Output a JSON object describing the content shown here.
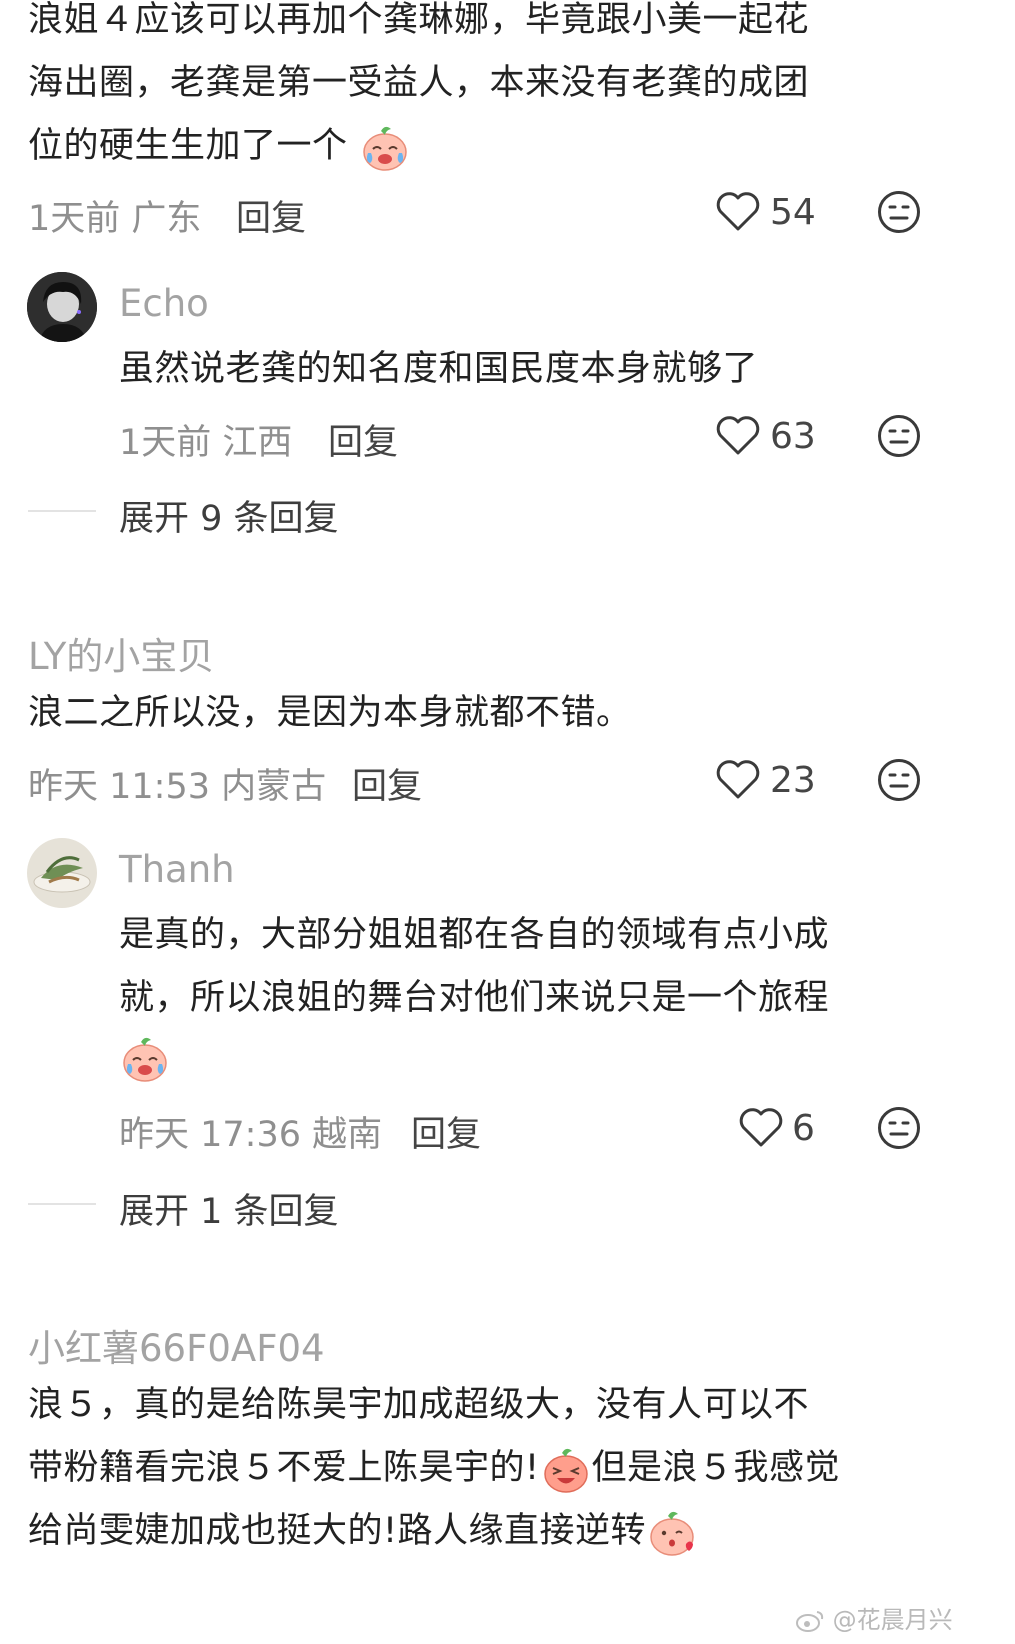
{
  "comments": [
    {
      "lines": [
        "浪姐４应该可以再加个龚琳娜，毕竟跟小美一起花",
        "海出圈，老龚是第一受益人，本来没有老龚的成团",
        "位的硬生生加了一个"
      ],
      "emoji": "crying-laughing-peach-emoji",
      "time_location": "1天前 广东",
      "reply": "回复",
      "likes": "54"
    },
    {
      "user": "Echo",
      "text": "虽然说老龚的知名度和国民度本身就够了",
      "time_location": "1天前 江西",
      "reply": "回复",
      "likes": "63"
    },
    {
      "expand": "展开 9 条回复"
    },
    {
      "user": "LY的小宝贝",
      "text": "浪二之所以没，是因为本身就都不错。",
      "time_location": "昨天 11:53 内蒙古",
      "reply": "回复",
      "likes": "23"
    },
    {
      "user": "Thanh",
      "lines": [
        "是真的，大部分姐姐都在各自的领域有点小成",
        "就，所以浪姐的舞台对他们来说只是一个旅程"
      ],
      "emoji": "crying-laughing-peach-emoji",
      "time_location": "昨天 17:36 越南",
      "reply": "回复",
      "likes": "6"
    },
    {
      "expand": "展开 1 条回复"
    },
    {
      "user": "小红薯66F0AF04",
      "lines": [
        "浪５，真的是给陈昊宇加成超级大，没有人可以不",
        "带粉籍看完浪５不爱上陈昊宇的!",
        "但是浪５我感觉",
        "给尚雯婕加成也挺大的!路人缘直接逆转"
      ],
      "emojis": [
        "laughing-peach-emoji",
        "kiss-peach-emoji"
      ]
    }
  ],
  "watermark": "@花晨月兴",
  "icons": {
    "like": "heart-outline-icon",
    "dislike": "meh-face-icon"
  },
  "colors": {
    "text": "#222222",
    "meta": "#8f8f8f",
    "username": "#a3a3a3",
    "background": "#ffffff"
  }
}
